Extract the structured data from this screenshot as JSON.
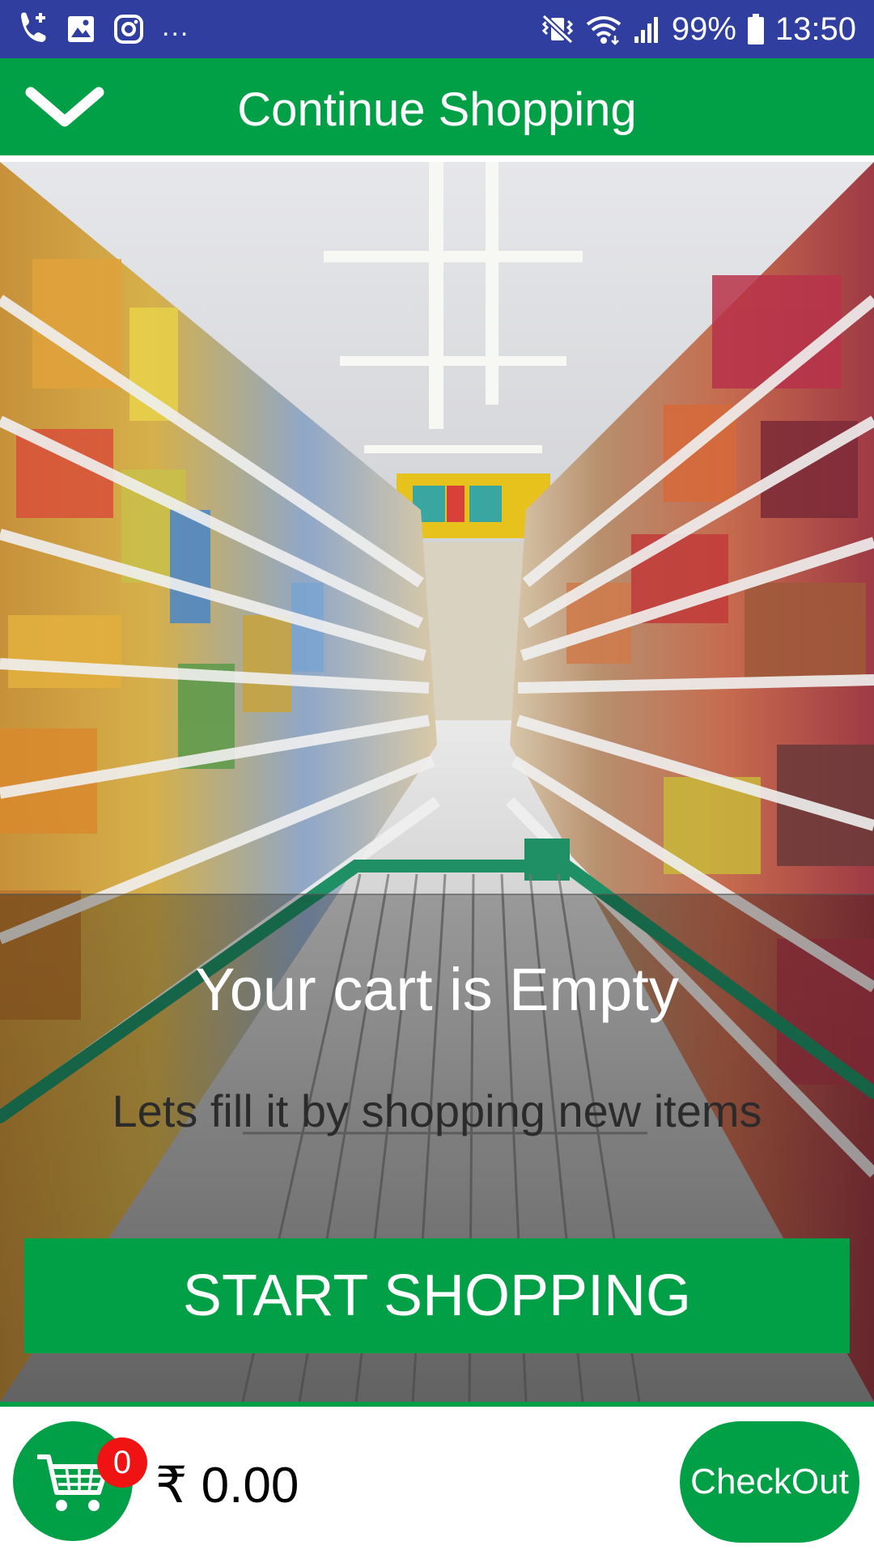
{
  "status_bar": {
    "left_icons": [
      "missed-call-icon",
      "gallery-icon",
      "instagram-icon"
    ],
    "overflow": "...",
    "right_icons": [
      "vibrate-icon",
      "wifi-icon",
      "signal-icon",
      "battery-icon"
    ],
    "battery": "99%",
    "time": "13:50"
  },
  "toolbar": {
    "collapse_icon": "chevron-down-icon",
    "title": "Continue Shopping"
  },
  "empty_cart": {
    "title": "Your cart is Empty",
    "subtitle": "Lets fill it by shopping new items",
    "button_label": "START SHOPPING"
  },
  "bottom_bar": {
    "cart_icon": "cart-icon",
    "cart_count": "0",
    "total": "₹ 0.00",
    "checkout_label": "CheckOut"
  },
  "colors": {
    "status_bar": "#303f9f",
    "primary_green": "#02a046",
    "badge_red": "#f01313"
  }
}
